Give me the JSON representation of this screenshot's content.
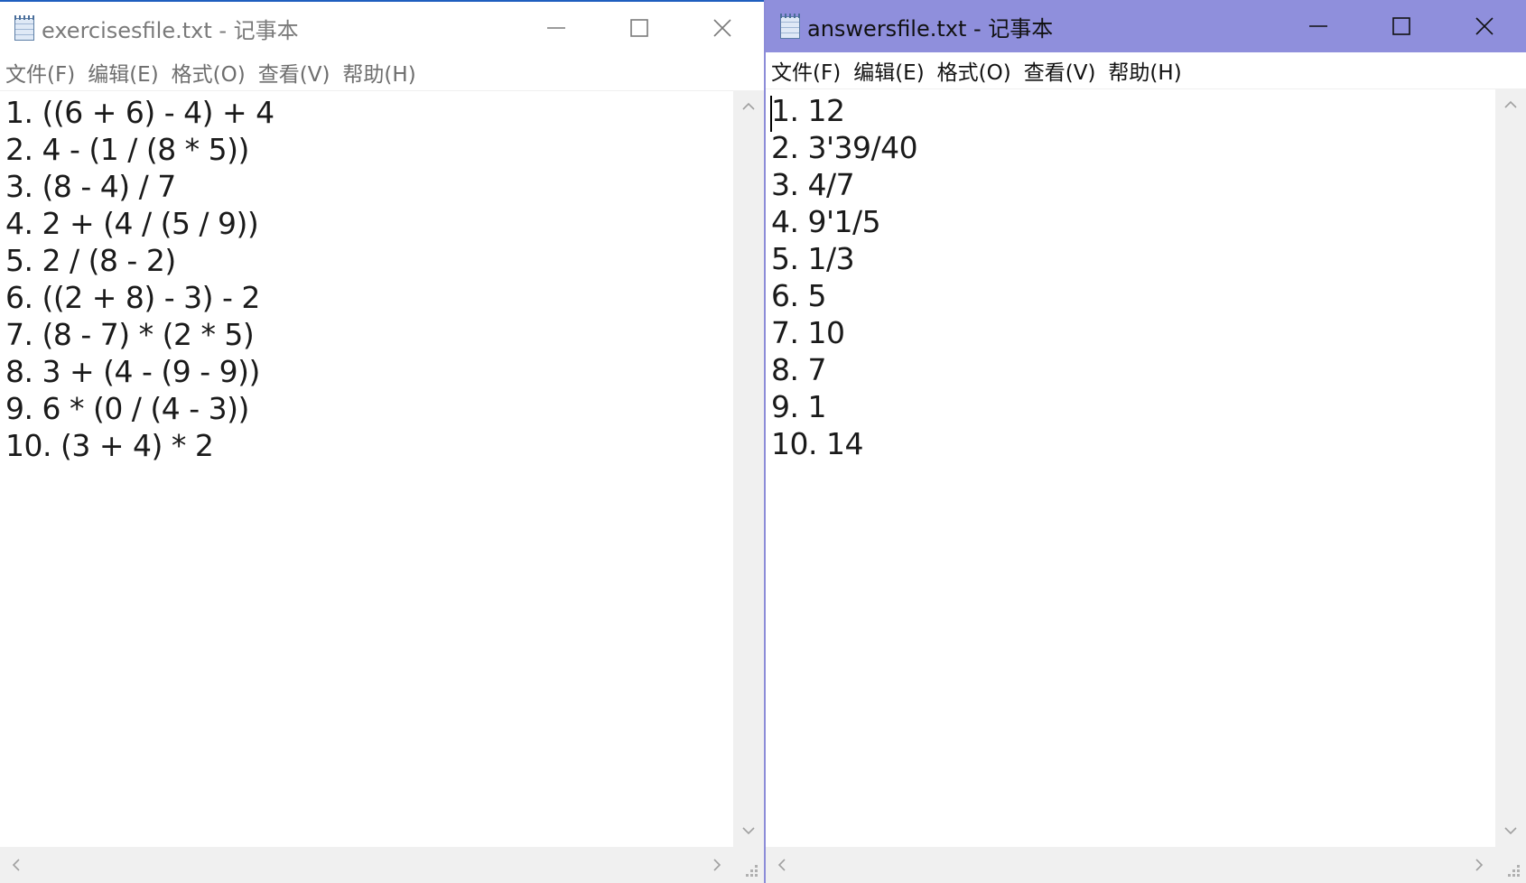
{
  "windows": [
    {
      "id": "exercises",
      "title": "exercisesfile.txt - 记事本",
      "active": false,
      "menu": [
        "文件(F)",
        "编辑(E)",
        "格式(O)",
        "查看(V)",
        "帮助(H)"
      ],
      "lines": [
        "1. ((6 + 6) - 4) + 4",
        "2. 4 - (1 / (8 * 5))",
        "3. (8 - 4) / 7",
        "4. 2 + (4 / (5 / 9))",
        "5. 2 / (8 - 2)",
        "6. ((2 + 8) - 3) - 2",
        "7. (8 - 7) * (2 * 5)",
        "8. 3 + (4 - (9 - 9))",
        "9. 6 * (0 / (4 - 3))",
        "10. (3 + 4) * 2"
      ]
    },
    {
      "id": "answers",
      "title": "answersfile.txt - 记事本",
      "active": true,
      "menu": [
        "文件(F)",
        "编辑(E)",
        "格式(O)",
        "查看(V)",
        "帮助(H)"
      ],
      "lines": [
        "1. 12",
        "2. 3'39/40",
        "3. 4/7",
        "4. 9'1/5",
        "5. 1/3",
        "6. 5",
        "7. 10",
        "8. 7",
        "9. 1",
        "10. 14"
      ]
    }
  ],
  "icons": {
    "app": "notepad-icon",
    "minimize": "minimize-icon",
    "maximize": "maximize-icon",
    "close": "close-icon"
  },
  "colors": {
    "active_titlebar": "#8f8fdc",
    "inactive_titlebar": "#ffffff",
    "active_border": "#1f5fbf"
  }
}
